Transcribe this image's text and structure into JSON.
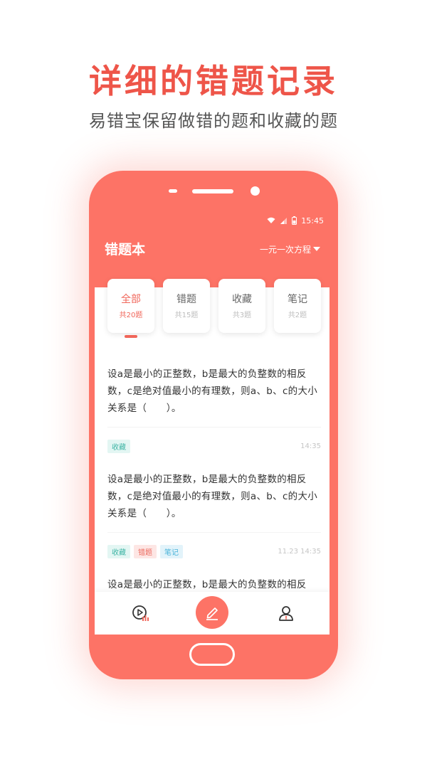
{
  "promo": {
    "headline": "详细的错题记录",
    "subline": "易错宝保留做错的题和收藏的题"
  },
  "status_bar": {
    "time": "15:45"
  },
  "app": {
    "title": "错题本",
    "filter_label": "一元一次方程",
    "accent_color": "#fd7366"
  },
  "tabs": [
    {
      "label": "全部",
      "count": "共20题",
      "active": true
    },
    {
      "label": "错题",
      "count": "共15题",
      "active": false
    },
    {
      "label": "收藏",
      "count": "共3题",
      "active": false
    },
    {
      "label": "笔记",
      "count": "共2题",
      "active": false
    }
  ],
  "items": [
    {
      "text": "设a是最小的正整数，b是最大的负整数的相反数，c是绝对值最小的有理数，则a、b、c的大小关系是（　　）。",
      "tags": [
        "收藏"
      ],
      "time": "14:35"
    },
    {
      "text": "设a是最小的正整数，b是最大的负整数的相反数，c是绝对值最小的有理数，则a、b、c的大小关系是（　　）。",
      "tags": [
        "收藏",
        "错题",
        "笔记"
      ],
      "time": "11.23 14:35"
    },
    {
      "text": "设a是最小的正整数，b是最大的负整数的相反",
      "tags": [],
      "time": ""
    }
  ],
  "bottom_nav": {
    "left_icon": "video-play-icon",
    "center_icon": "pencil-icon",
    "right_icon": "user-icon"
  }
}
